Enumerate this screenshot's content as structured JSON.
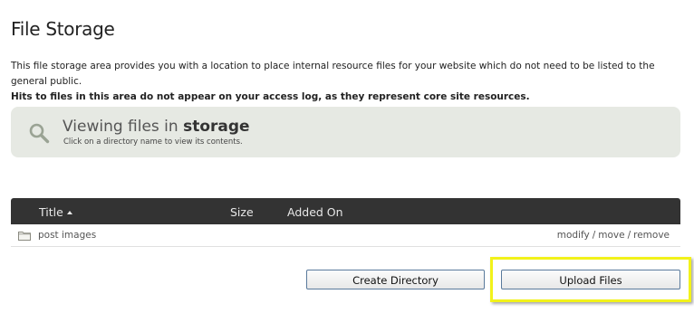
{
  "page": {
    "title": "File Storage",
    "intro": "This file storage area provides you with a location to place internal resource files for your website which do not need to be listed to the general public.",
    "intro_bold": "Hits to files in this area do not appear on your access log, as they represent core site resources."
  },
  "info_box": {
    "icon": "search-icon",
    "heading_prefix": "Viewing files in",
    "heading_location": "storage",
    "subtext": "Click on a directory name to view its contents."
  },
  "table": {
    "columns": {
      "title": "Title",
      "size": "Size",
      "added_on": "Added On"
    },
    "sort": "title-ascending",
    "rows": [
      {
        "icon": "folder-icon",
        "name": "post images",
        "size": "",
        "added_on": "",
        "actions": {
          "modify": "modify",
          "separator_1": "/",
          "move": "move",
          "separator_2": "/",
          "remove": "remove"
        }
      }
    ]
  },
  "buttons": {
    "create_directory": "Create Directory",
    "upload_files": "Upload Files"
  },
  "colors": {
    "header_bar": "#333333",
    "info_box_bg": "#e6e9e3",
    "highlight": "#f2f21a",
    "button_border": "#5a7a9c"
  }
}
